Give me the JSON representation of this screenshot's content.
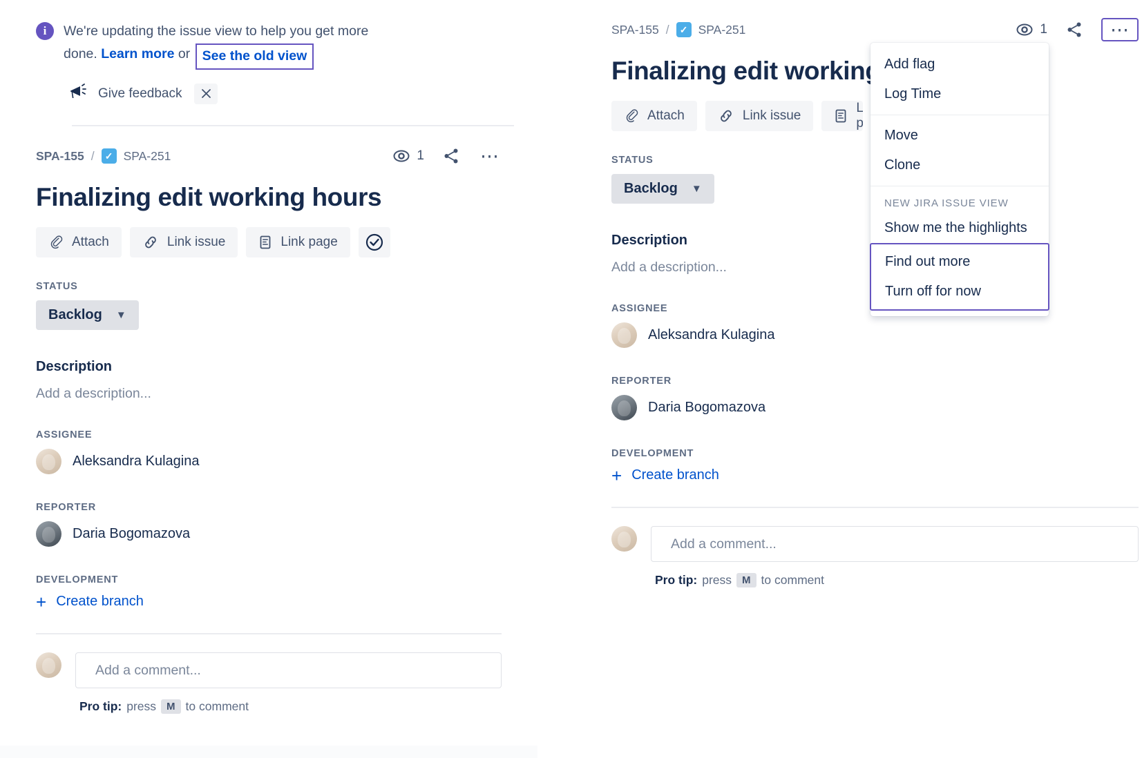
{
  "banner": {
    "icon": "info-icon",
    "message_line1": "We're updating the issue view to help you get more",
    "message_line2_prefix": "done. ",
    "learn_more": "Learn more",
    "or_text": " or ",
    "see_old_view": "See the old view",
    "feedback_icon": "megaphone-icon",
    "feedback_label": "Give feedback",
    "close_icon": "close-icon",
    "highlight_color": "#6554c0"
  },
  "issue": {
    "breadcrumb_parent": "SPA-155",
    "breadcrumb_separator": "/",
    "breadcrumb_current": "SPA-251",
    "type_icon": "task-check-icon",
    "title": "Finalizing edit working hours",
    "title_truncated": "Finalizing edit working ho",
    "watch_icon": "eye-icon",
    "watch_count": "1",
    "share_icon": "share-icon",
    "more_icon": "more-ellipsis-icon",
    "toolbar": [
      {
        "label": "Attach",
        "icon": "paperclip-icon"
      },
      {
        "label": "Link issue",
        "icon": "link-icon"
      },
      {
        "label": "Link page",
        "icon": "page-icon"
      }
    ],
    "toolbar_extra_icon": "check-circle-icon",
    "status_label": "STATUS",
    "status_value": "Backlog",
    "status_chevron": "chevron-down-icon",
    "description_label": "Description",
    "description_placeholder": "Add a description...",
    "assignee_label": "ASSIGNEE",
    "assignee_name": "Aleksandra Kulagina",
    "reporter_label": "REPORTER",
    "reporter_name": "Daria Bogomazova",
    "development_label": "DEVELOPMENT",
    "create_branch_label": "Create branch",
    "create_branch_icon": "plus-icon",
    "comment_placeholder": "Add a comment...",
    "protip_bold": "Pro tip:",
    "protip_text_before": " press ",
    "protip_key": "M",
    "protip_text_after": " to comment"
  },
  "menu": {
    "items_group1": [
      "Add flag",
      "Log Time"
    ],
    "items_group2": [
      "Move",
      "Clone"
    ],
    "section_heading": "NEW JIRA ISSUE VIEW",
    "items_group3": [
      "Show me the highlights"
    ],
    "items_highlighted": [
      "Find out more",
      "Turn off for now"
    ],
    "highlight_color": "#6554c0"
  },
  "colors": {
    "link": "#0052cc",
    "text": "#172b4d",
    "subtle": "#5e6c84",
    "placeholder": "#7a869a",
    "chip_blue": "#4bade8",
    "pill_gray": "#dfe1e6",
    "button_gray": "#f4f5f7",
    "purple": "#6554c0"
  }
}
